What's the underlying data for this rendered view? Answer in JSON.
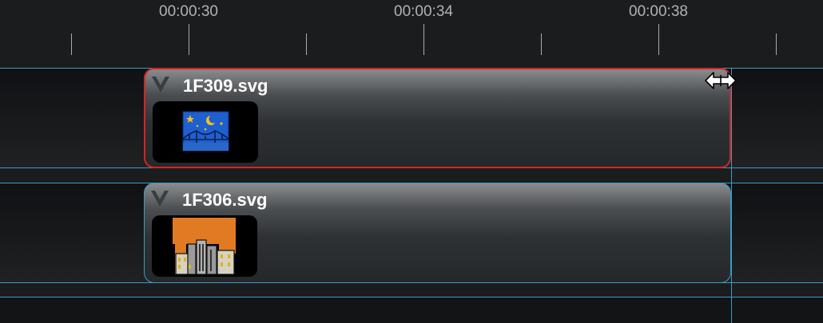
{
  "ruler": {
    "labels": [
      "00:00:30",
      "00:00:34",
      "00:00:38"
    ]
  },
  "clips": [
    {
      "name": "1F309.svg",
      "thumbnail_icon": "night-bridge-icon",
      "selected": true
    },
    {
      "name": "1F306.svg",
      "thumbnail_icon": "city-sunset-icon",
      "selected": false
    }
  ],
  "colors": {
    "selection": "#d42525",
    "track_border": "#3a9bc7",
    "background": "#1b1c1d"
  },
  "cursor": "resize-horizontal-cursor-icon"
}
